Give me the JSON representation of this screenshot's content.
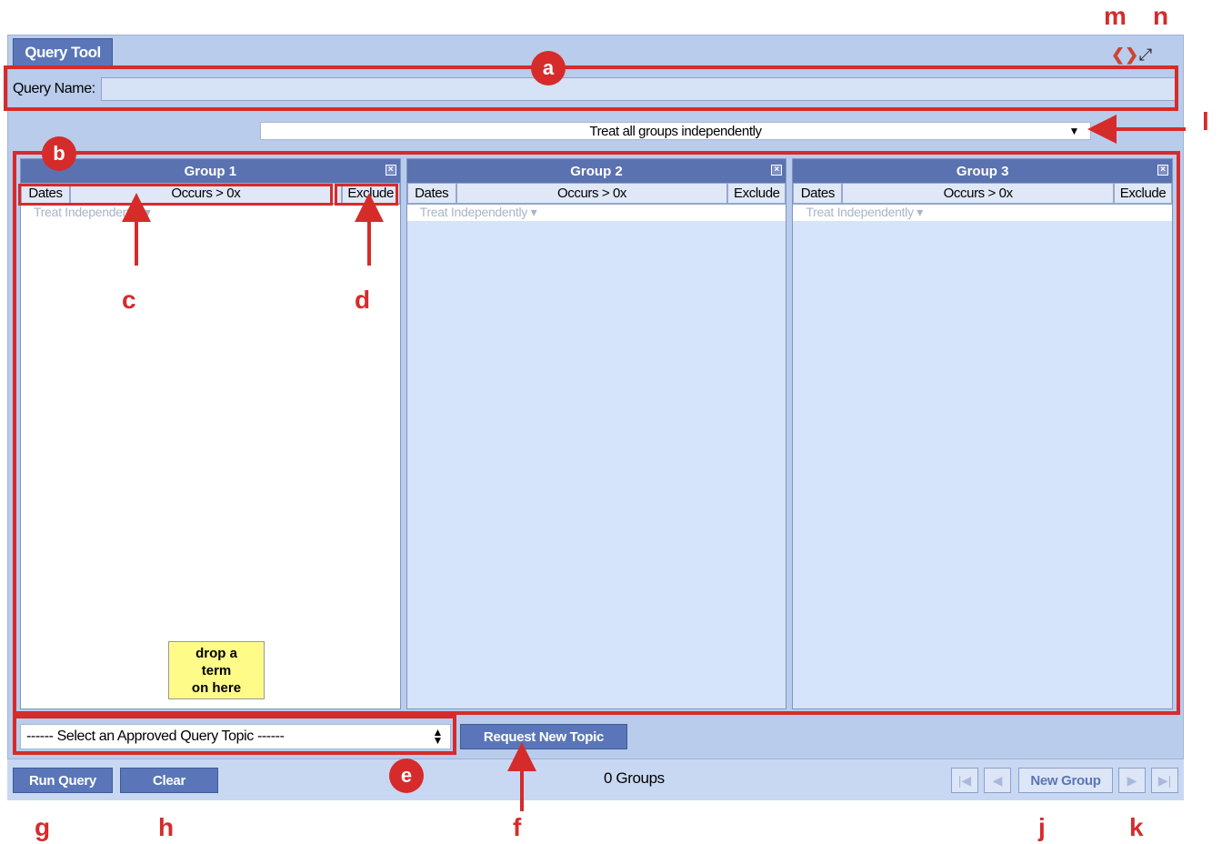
{
  "window": {
    "tab_label": "Query Tool"
  },
  "icons": {
    "doc": "document-icon",
    "expand": "expand-icon"
  },
  "query_name": {
    "label": "Query Name:",
    "value": "",
    "placeholder": ""
  },
  "combine": {
    "selected": "Treat all groups independently"
  },
  "groups": [
    {
      "title": "Group 1",
      "dates": "Dates",
      "occurs": "Occurs > 0x",
      "exclude": "Exclude",
      "timing": "Treat Independently ▾",
      "drop_hint": "drop a\nterm\non here"
    },
    {
      "title": "Group 2",
      "dates": "Dates",
      "occurs": "Occurs > 0x",
      "exclude": "Exclude",
      "timing": "Treat Independently ▾"
    },
    {
      "title": "Group 3",
      "dates": "Dates",
      "occurs": "Occurs > 0x",
      "exclude": "Exclude",
      "timing": "Treat Independently ▾"
    }
  ],
  "topic": {
    "selected": "------ Select an Approved Query Topic ------",
    "request_label": "Request New Topic"
  },
  "footer": {
    "run_label": "Run Query",
    "clear_label": "Clear",
    "count": "0 Groups",
    "new_group_label": "New Group"
  },
  "annotations": {
    "a": "a",
    "b": "b",
    "c": "c",
    "d": "d",
    "e": "e",
    "f": "f",
    "g": "g",
    "h": "h",
    "j": "j",
    "k": "k",
    "l": "l",
    "m": "m",
    "n": "n"
  },
  "colors": {
    "annotation": "#d62b2b",
    "button": "#5a76b8",
    "panel": "#b9ccec"
  }
}
